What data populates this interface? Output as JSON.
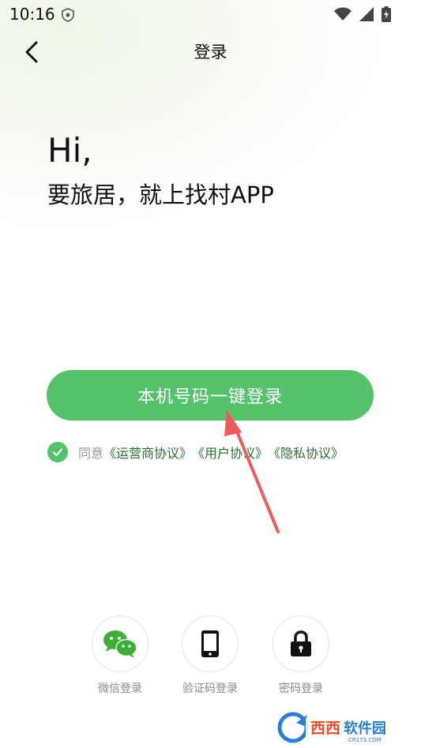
{
  "status": {
    "time": "10:16"
  },
  "header": {
    "title": "登录"
  },
  "greeting": {
    "hi": "Hi,",
    "subtitle": "要旅居，就上找村APP"
  },
  "login_button": {
    "label": "本机号码一键登录"
  },
  "agreement": {
    "prefix": "同意",
    "links": [
      "《运营商协议》",
      "《用户协议》",
      "《隐私协议》"
    ]
  },
  "alt_logins": [
    {
      "label": "微信登录",
      "icon": "wechat-icon"
    },
    {
      "label": "验证码登录",
      "icon": "phone-icon"
    },
    {
      "label": "密码登录",
      "icon": "lock-icon"
    }
  ],
  "watermark": {
    "text": "西西软件园",
    "sub": "CR173.COM"
  },
  "colors": {
    "accent": "#55c26c",
    "link": "#2a6e34",
    "arrow": "#ef5a5a"
  }
}
